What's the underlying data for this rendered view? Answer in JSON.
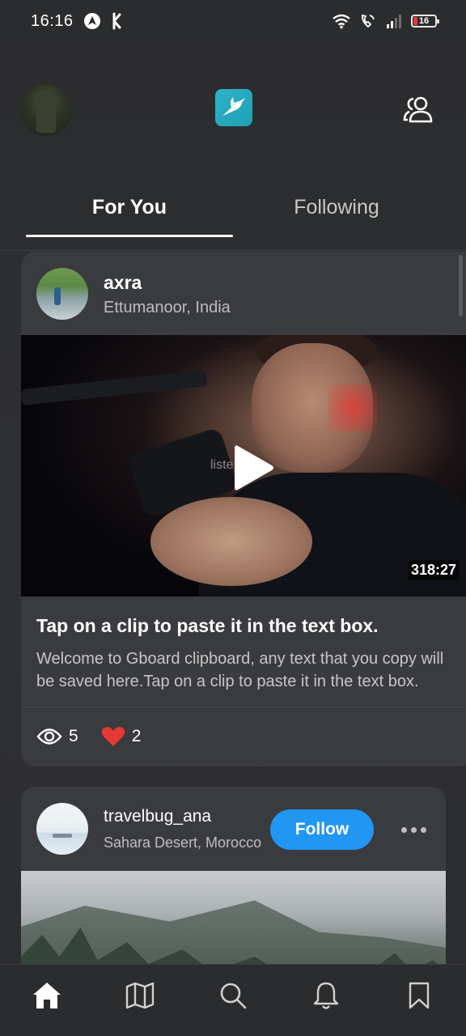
{
  "status_bar": {
    "time": "16:16",
    "battery": "16"
  },
  "header": {
    "logo_icon": "hummingbird-icon",
    "people_icon": "people-icon"
  },
  "tabs": [
    {
      "label": "For You",
      "active": true
    },
    {
      "label": "Following",
      "active": false
    }
  ],
  "posts": [
    {
      "username": "axra",
      "location": "Ettumanoor, India",
      "video_overlay_text": "liste",
      "duration": "318:27",
      "title": "Tap on a clip to paste it in the text box.",
      "body": "Welcome to Gboard clipboard, any text that you copy will be saved here.Tap on a clip to paste it in the text box.",
      "views": "5",
      "likes": "2"
    },
    {
      "username": "travelbug_ana",
      "location": "Sahara Desert, Morocco",
      "follow_label": "Follow"
    }
  ],
  "bottom_nav": [
    {
      "icon": "home-icon",
      "active": true
    },
    {
      "icon": "map-icon",
      "active": false
    },
    {
      "icon": "search-icon",
      "active": false
    },
    {
      "icon": "bell-icon",
      "active": false
    },
    {
      "icon": "bookmark-icon",
      "active": false
    }
  ],
  "colors": {
    "background": "#2b2c2e",
    "card": "#3a3b3e",
    "accent_blue": "#2196f3",
    "like_red": "#e53935",
    "logo_teal": "#2fb3c6"
  }
}
